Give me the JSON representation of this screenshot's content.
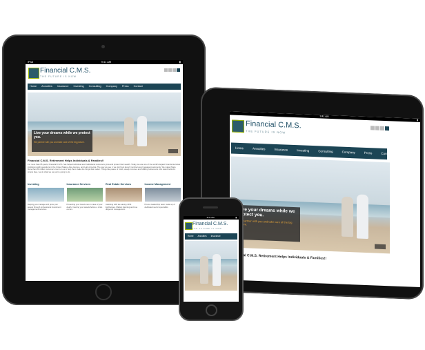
{
  "site": {
    "brand": "Financial C.M.S.",
    "tagline": "THE FUTURE IS NOW",
    "nav": [
      "Home",
      "Annuities",
      "Insurance",
      "Investing",
      "Consulting",
      "Company",
      "Press",
      "Contact"
    ],
    "hero_caption": "Live your dreams while we protect you.",
    "hero_sub": "We partner with you and take care of the big picture.",
    "headline": "Financial C.M.S. Retirement Helps Individuals & Families!!",
    "intro": "For more than 65 years, Financial C.M.S. has helped individual and institutional customers grow and protect their wealth. Today, we are one of the world's largest financial services institutions with operations in the United States, Asia, Europe, and Latin America. The way we see it, we don't just launch numbers and manage investments. We make things. More than 80 million customers count on us to help them make the things that matter. Things like peace of mind, steady incomes and fulfilling retirements. We stand behind a simple idea, we do what we say we're going to do.",
    "columns": [
      {
        "title": "Investing",
        "text": "Helping you manage and grow your assets through professional investment management services"
      },
      {
        "title": "Insurance Services",
        "text": "Protecting your loved ones in case of your death. Insuring your assets before a crisis occurs."
      },
      {
        "title": "Real Estate Services",
        "text": "Assisting with tax-saving 1031 Exchanges. Market planning and due diligence management."
      },
      {
        "title": "Income Management",
        "text": "Proven leadership team made up of dedicated sector specialists"
      }
    ]
  },
  "ipad_status": {
    "carrier": "iPad",
    "time": "9:41 AM"
  },
  "iphone_status": {
    "time": "9:41 AM"
  },
  "social_icons": [
    "facebook-icon",
    "twitter-icon",
    "linkedin-icon",
    "email-icon"
  ],
  "colors": {
    "nav": "#1c4555",
    "accent": "#e2a23a",
    "brand": "#1f4f66"
  }
}
